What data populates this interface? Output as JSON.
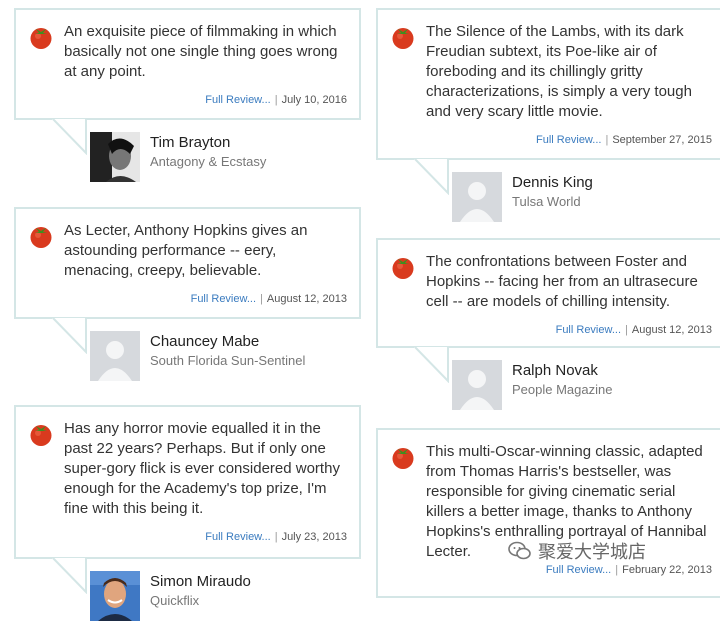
{
  "reviews_left": [
    {
      "quote": "An exquisite piece of filmmaking in which basically not one single thing goes wrong at any point.",
      "link_label": "Full Review...",
      "date": "July 10, 2016",
      "critic": "Tim Brayton",
      "publication": "Antagony & Ecstasy",
      "avatar": "photo-avatar-dark"
    },
    {
      "quote": "As Lecter, Anthony Hopkins gives an astounding performance -- eery, menacing, creepy, believable.",
      "link_label": "Full Review...",
      "date": "August 12, 2013",
      "critic": "Chauncey Mabe",
      "publication": "South Florida Sun-Sentinel",
      "avatar": "placeholder-avatar"
    },
    {
      "quote": "Has any horror movie equalled it in the past 22 years? Perhaps. But if only one super-gory flick is ever considered worthy enough for the Academy's top prize, I'm fine with this being it.",
      "link_label": "Full Review...",
      "date": "July 23, 2013",
      "critic": "Simon Miraudo",
      "publication": "Quickflix",
      "avatar": "photo-avatar-smiling"
    }
  ],
  "reviews_right": [
    {
      "quote": "The Silence of the Lambs, with its dark Freudian subtext, its Poe-like air of foreboding and its chillingly gritty characterizations, is simply a very tough and very scary little movie.",
      "link_label": "Full Review...",
      "date": "September 27, 2015",
      "critic": "Dennis King",
      "publication": "Tulsa World",
      "avatar": "placeholder-avatar"
    },
    {
      "quote": "The confrontations between Foster and Hopkins -- facing her from an ultrasecure cell -- are models of chilling intensity.",
      "link_label": "Full Review...",
      "date": "August 12, 2013",
      "critic": "Ralph Novak",
      "publication": "People Magazine",
      "avatar": "placeholder-avatar"
    },
    {
      "quote": "This multi-Oscar-winning classic, adapted from Thomas Harris's bestseller, was responsible for giving cinematic serial killers a better image, thanks to Anthony Hopkins's enthralling portrayal of Hannibal Lecter.",
      "link_label": "Full Review...",
      "date": "February 22, 2013",
      "critic": "",
      "publication": "",
      "avatar": ""
    }
  ],
  "watermark": "聚爱大学城店",
  "icons": {
    "fresh": "tomato-icon",
    "watermark": "wechat-icon"
  },
  "colors": {
    "border": "#d4e6e6",
    "link": "#3a7bbf",
    "tomato": "#d93a1e"
  }
}
